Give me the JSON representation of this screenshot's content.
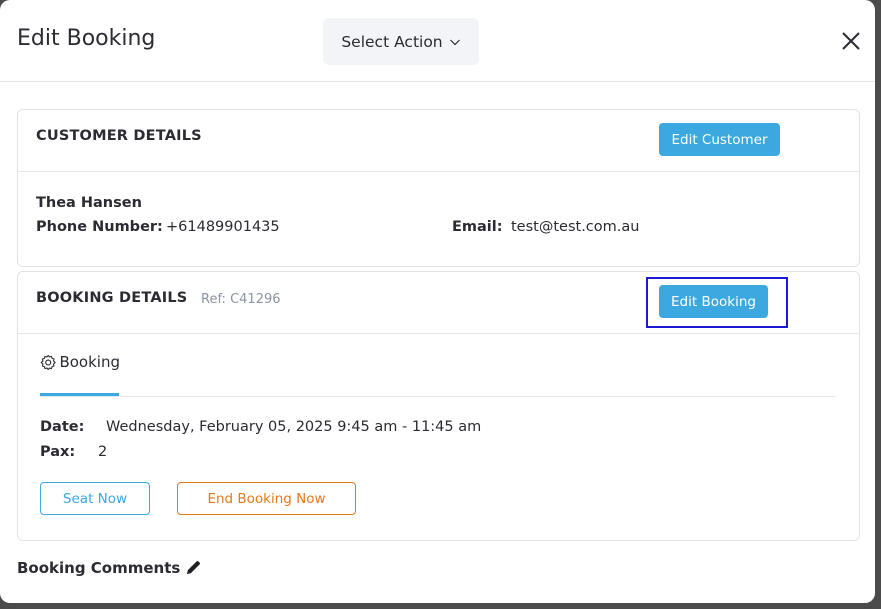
{
  "modal": {
    "title": "Edit Booking",
    "select_action": "Select Action",
    "close_icon": "close-icon"
  },
  "customer": {
    "section_title": "CUSTOMER DETAILS",
    "edit_button": "Edit Customer",
    "name": "Thea Hansen",
    "phone_label": "Phone Number:",
    "phone_value": "+61489901435",
    "email_label": "Email:",
    "email_value": "test@test.com.au"
  },
  "booking": {
    "section_title": "BOOKING DETAILS",
    "ref": "Ref: C41296",
    "edit_button": "Edit Booking",
    "tab_label": "Booking",
    "tab_icon": "gear-icon",
    "date_label": "Date:",
    "date_value": "Wednesday, February 05, 2025 9:45 am - 11:45 am",
    "pax_label": "Pax:",
    "pax_value": "2",
    "seat_button": "Seat Now",
    "end_button": "End Booking Now"
  },
  "comments": {
    "label": "Booking Comments",
    "icon": "pencil-icon"
  },
  "colors": {
    "accent": "#3ba8e0",
    "end_button": "#e07a1c",
    "highlight": "#1a1ad6"
  }
}
